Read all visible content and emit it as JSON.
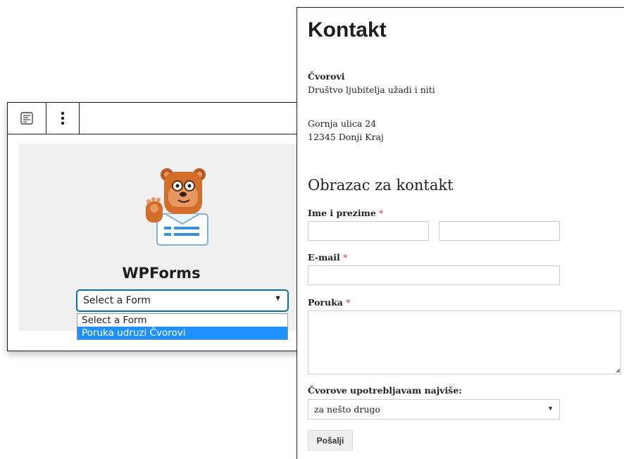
{
  "editor": {
    "plugin_title": "WPForms",
    "select": {
      "value": "Select a Form",
      "options": [
        "Select a Form",
        "Poruka udruzi Čvorovi"
      ],
      "highlighted": "Poruka udruzi Čvorovi"
    },
    "icons": {
      "block": "form-block-icon",
      "more": "more-options-icon"
    },
    "colors": {
      "highlight": "#1e90ff",
      "focus": "#0b6ea6",
      "mascot": "#d26d2a"
    }
  },
  "page": {
    "title": "Kontakt",
    "org_name": "Čvorovi",
    "org_description": "Društvo ljubitelja užadi i niti",
    "address_line1": "Gornja ulica 24",
    "address_line2": "12345 Donji Kraj",
    "form": {
      "heading": "Obrazac za kontakt",
      "required_mark": "*",
      "name_label": "Ime i prezime",
      "email_label": "E-mail",
      "message_label": "Poruka",
      "usage_label": "Čvorove upotrebljavam najviše:",
      "usage_value": "za nešto drugo",
      "submit_label": "Pošalji"
    }
  }
}
